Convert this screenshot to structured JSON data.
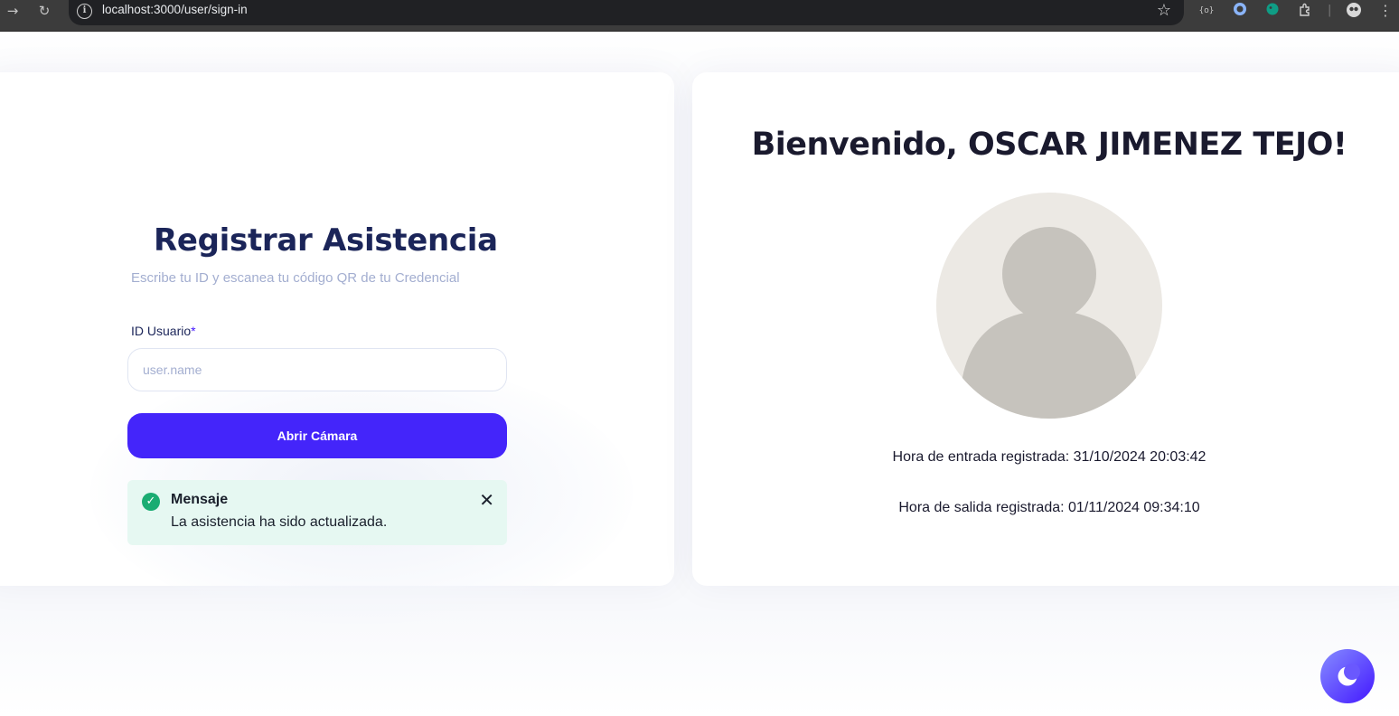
{
  "browser": {
    "url": "localhost:3000/user/sign-in"
  },
  "register": {
    "title": "Registrar Asistencia",
    "subtitle": "Escribe tu ID y escanea tu código QR de tu Credencial",
    "id_label": "ID Usuario",
    "required_mark": "*",
    "id_placeholder": "user.name",
    "open_camera": "Abrir Cámara"
  },
  "alert": {
    "title": "Mensaje",
    "message": "La asistencia ha sido actualizada.",
    "status_color": "#1aac72"
  },
  "welcome": {
    "title": "Bienvenido, OSCAR JIMENEZ TEJO!",
    "entry_time": "Hora de entrada registrada: 31/10/2024 20:03:42",
    "exit_time": "Hora de salida registrada: 01/11/2024 09:34:10"
  },
  "colors": {
    "brand": "#4425fa",
    "heading": "#1b2559",
    "muted": "#a3aed0"
  },
  "icons": {
    "dark_mode_toggle": "moon-icon",
    "avatar": "user-placeholder-icon",
    "alert_status": "check-circle-icon",
    "alert_close": "close-icon"
  }
}
